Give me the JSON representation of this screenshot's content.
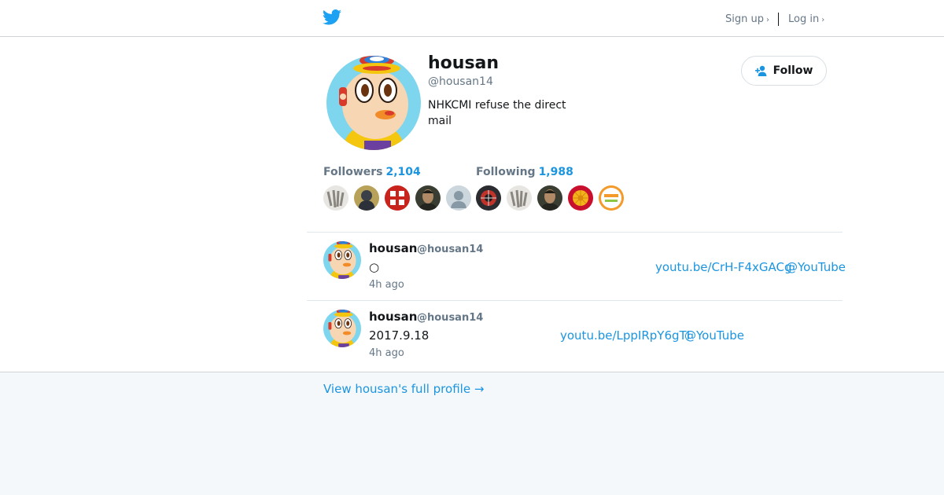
{
  "header": {
    "logo_icon": "twitter-bird-icon",
    "signup": "Sign up",
    "login": "Log in",
    "chevron": "›"
  },
  "profile": {
    "name": "housan",
    "handle": "@housan14",
    "bio": "NHKCMI refuse the direct mail",
    "follow_label": "Follow",
    "follow_icon": "follow-person-icon",
    "followers_label": "Followers",
    "followers_count": "2,104",
    "following_label": "Following",
    "following_count": "1,988"
  },
  "followers_faces": [
    "grayscale-art",
    "dark-figure",
    "red-kanji-badge",
    "man-portrait",
    "default-silhouette"
  ],
  "following_faces": [
    "red-circle-pattern",
    "grayscale-art",
    "man-portrait",
    "chrysanthemum-crest",
    "orange-badge"
  ],
  "tweets": [
    {
      "name": "housan",
      "handle": "@housan14",
      "text": "○",
      "link": "youtu.be/CrH-F4xGACg",
      "mention": "@YouTube",
      "time": "4h ago"
    },
    {
      "name": "housan",
      "handle": "@housan14",
      "text": "2017.9.18",
      "link": "youtu.be/LppIRpY6gTI",
      "mention": "@YouTube",
      "time": "4h ago"
    }
  ],
  "footer": {
    "view_profile": "View housan's full profile →"
  },
  "colors": {
    "accent": "#1b95e0",
    "muted": "#657786",
    "background": "#f5f8fa"
  }
}
